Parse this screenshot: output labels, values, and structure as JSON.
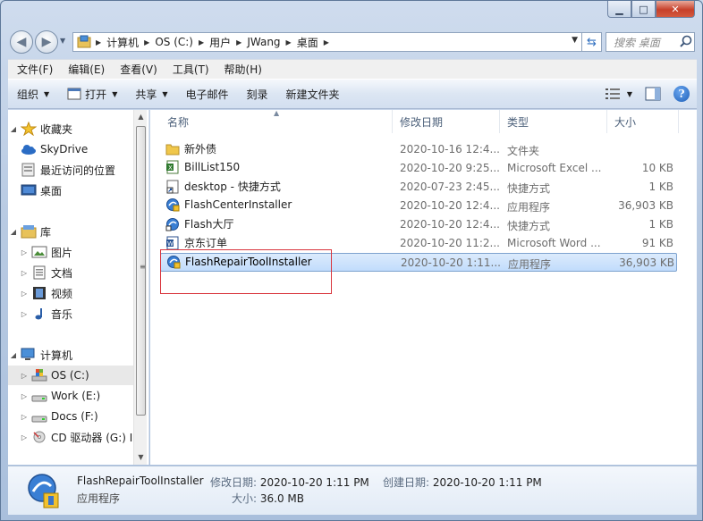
{
  "window": {
    "controls": {
      "minimize": "▁",
      "maximize": "□",
      "close": "✕"
    }
  },
  "address": {
    "crumbs": [
      "计算机",
      "OS (C:)",
      "用户",
      "JWang",
      "桌面"
    ],
    "search_placeholder": "搜索 桌面"
  },
  "menu": [
    "文件(F)",
    "编辑(E)",
    "查看(V)",
    "工具(T)",
    "帮助(H)"
  ],
  "commands": {
    "organize": "组织",
    "open": "打开",
    "share": "共享",
    "email": "电子邮件",
    "burn": "刻录",
    "new_folder": "新建文件夹"
  },
  "nav": {
    "favorites": {
      "label": "收藏夹",
      "items": [
        "SkyDrive",
        "最近访问的位置",
        "桌面"
      ]
    },
    "libraries": {
      "label": "库",
      "items": [
        "图片",
        "文档",
        "视频",
        "音乐"
      ]
    },
    "computer": {
      "label": "计算机",
      "items": [
        "OS (C:)",
        "Work (E:)",
        "Docs (F:)",
        "CD 驱动器 (G:) I"
      ]
    }
  },
  "columns": {
    "name": "名称",
    "date": "修改日期",
    "type": "类型",
    "size": "大小"
  },
  "files": [
    {
      "name": "新外债",
      "date": "2020-10-16 12:4...",
      "type": "文件夹",
      "size": "",
      "icon": "folder-icon"
    },
    {
      "name": "BillList150",
      "date": "2020-10-20 9:25...",
      "type": "Microsoft Excel ...",
      "size": "10 KB",
      "icon": "excel-icon"
    },
    {
      "name": "desktop - 快捷方式",
      "date": "2020-07-23 2:45...",
      "type": "快捷方式",
      "size": "1 KB",
      "icon": "shortcut-icon"
    },
    {
      "name": "FlashCenterInstaller",
      "date": "2020-10-20 12:4...",
      "type": "应用程序",
      "size": "36,903 KB",
      "icon": "installer-icon"
    },
    {
      "name": "Flash大厅",
      "date": "2020-10-20 12:4...",
      "type": "快捷方式",
      "size": "1 KB",
      "icon": "flash-shortcut-icon"
    },
    {
      "name": "京东订单",
      "date": "2020-10-20 11:2...",
      "type": "Microsoft Word ...",
      "size": "91 KB",
      "icon": "word-icon"
    },
    {
      "name": "FlashRepairToolInstaller",
      "date": "2020-10-20 1:11...",
      "type": "应用程序",
      "size": "36,903 KB",
      "icon": "installer-icon",
      "selected": true
    }
  ],
  "details": {
    "name": "FlashRepairToolInstaller",
    "type": "应用程序",
    "modified_label": "修改日期:",
    "modified_value": "2020-10-20 1:11 PM",
    "created_label": "创建日期:",
    "created_value": "2020-10-20 1:11 PM",
    "size_label": "大小:",
    "size_value": "36.0 MB"
  }
}
